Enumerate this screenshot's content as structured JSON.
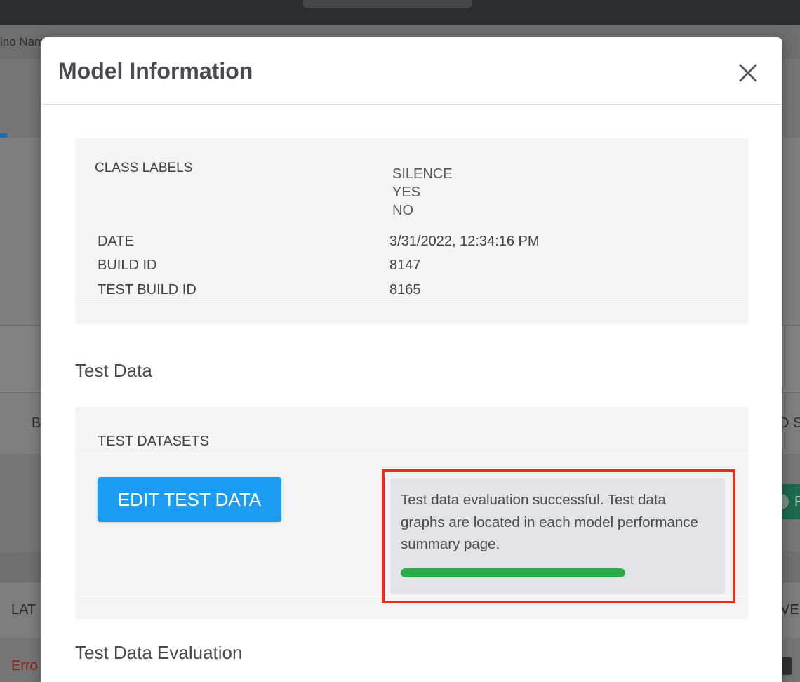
{
  "background": {
    "subbar_text": "ino Nam",
    "fragment_left_1": "B",
    "fragment_right_1": "D S",
    "fragment_left_2": "LAT",
    "fragment_right_2": "VE",
    "fragment_error": "Erro",
    "fragment_button": "F"
  },
  "modal": {
    "title": "Model Information",
    "close_icon": "close-icon"
  },
  "model_info": {
    "class_labels_label": "CLASS LABELS",
    "class_labels": [
      "SILENCE",
      "YES",
      "NO"
    ],
    "rows": [
      {
        "label": "DATE",
        "value": "3/31/2022, 12:34:16 PM"
      },
      {
        "label": "BUILD ID",
        "value": "8147"
      },
      {
        "label": "TEST BUILD ID",
        "value": "8165"
      }
    ]
  },
  "test_data": {
    "section_title": "Test Data",
    "datasets_label": "TEST DATASETS",
    "edit_button_label": "EDIT TEST DATA",
    "evaluation_message": "Test data evaluation successful. Test data graphs are located in each model performance summary page.",
    "progress_percent": 100
  },
  "evaluation": {
    "section_title": "Test Data Evaluation"
  },
  "colors": {
    "primary_button": "#1b9cf0",
    "progress_success": "#2cab49",
    "highlight": "#ee2b1b"
  }
}
